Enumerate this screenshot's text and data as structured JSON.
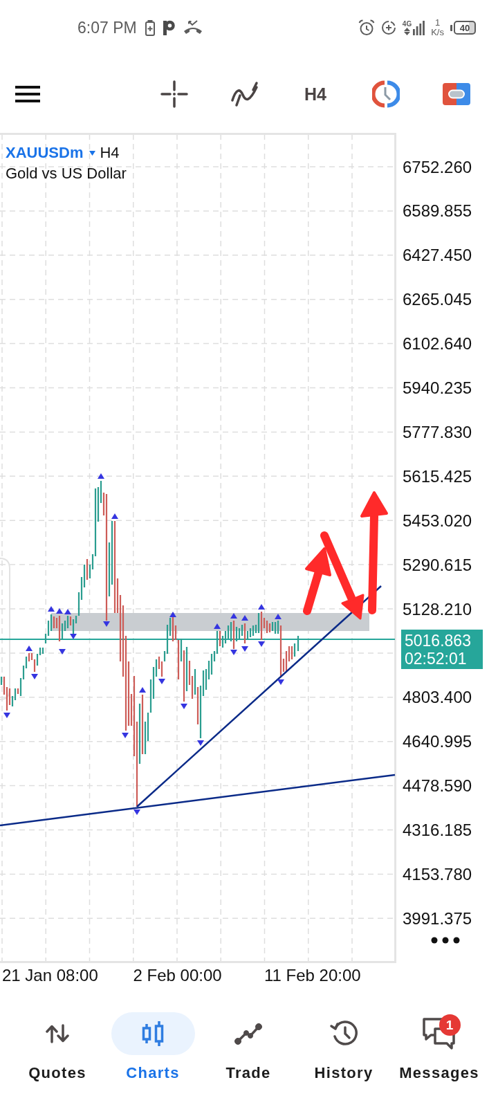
{
  "status_bar": {
    "time": "6:07 PM",
    "network_type": "4G",
    "speed_value": "1",
    "speed_unit": "K/s",
    "battery": "40"
  },
  "toolbar": {
    "timeframe": "H4"
  },
  "chart": {
    "symbol": "XAUUSDm",
    "timeframe": "H4",
    "description": "Gold vs US Dollar",
    "price_labels": [
      "6752.260",
      "6589.855",
      "6427.450",
      "6265.045",
      "6102.640",
      "5940.235",
      "5777.830",
      "5615.425",
      "5453.020",
      "5290.615",
      "5128.210",
      "4803.400",
      "4640.995",
      "4478.590",
      "4316.185",
      "4153.780",
      "3991.375"
    ],
    "current_price": "5016.863",
    "countdown": "02:52:01",
    "time_labels": [
      "21 Jan 08:00",
      "2 Feb 00:00",
      "11 Feb 20:00"
    ]
  },
  "nav": [
    {
      "label": "Quotes",
      "selected": false
    },
    {
      "label": "Charts",
      "selected": true
    },
    {
      "label": "Trade",
      "selected": false
    },
    {
      "label": "History",
      "selected": false
    },
    {
      "label": "Messages",
      "selected": false,
      "badge": "1"
    }
  ]
}
